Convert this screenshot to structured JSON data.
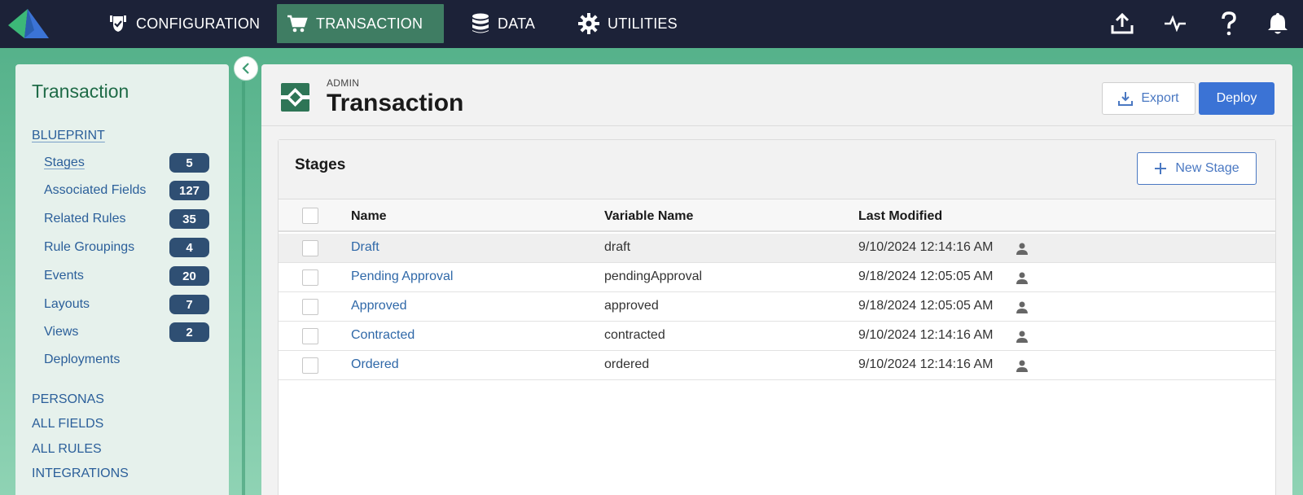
{
  "nav": {
    "items": [
      {
        "label": "CONFIGURATION",
        "icon": "shield-check-icon"
      },
      {
        "label": "TRANSACTION",
        "icon": "shopping-cart-icon"
      },
      {
        "label": "DATA",
        "icon": "database-icon"
      },
      {
        "label": "UTILITIES",
        "icon": "gear-icon"
      }
    ],
    "active": "TRANSACTION",
    "right_icons": [
      "upload-icon",
      "activity-icon",
      "help-icon",
      "bell-icon"
    ]
  },
  "sidebar": {
    "title": "Transaction",
    "blueprint_label": "BLUEPRINT",
    "items": [
      {
        "label": "Stages",
        "count": "5"
      },
      {
        "label": "Associated Fields",
        "count": "127"
      },
      {
        "label": "Related Rules",
        "count": "35"
      },
      {
        "label": "Rule Groupings",
        "count": "4"
      },
      {
        "label": "Events",
        "count": "20"
      },
      {
        "label": "Layouts",
        "count": "7"
      },
      {
        "label": "Views",
        "count": "2"
      },
      {
        "label": "Deployments",
        "count": ""
      }
    ],
    "sections": [
      "PERSONAS",
      "ALL FIELDS",
      "ALL RULES",
      "INTEGRATIONS"
    ]
  },
  "header": {
    "overline": "ADMIN",
    "title": "Transaction",
    "export_label": "Export",
    "deploy_label": "Deploy"
  },
  "stages": {
    "title": "Stages",
    "new_label": "New Stage",
    "columns": [
      "Name",
      "Variable Name",
      "Last Modified"
    ],
    "rows": [
      {
        "name": "Draft",
        "variable": "draft",
        "modified": "9/10/2024 12:14:16 AM"
      },
      {
        "name": "Pending Approval",
        "variable": "pendingApproval",
        "modified": "9/18/2024 12:05:05 AM"
      },
      {
        "name": "Approved",
        "variable": "approved",
        "modified": "9/18/2024 12:05:05 AM"
      },
      {
        "name": "Contracted",
        "variable": "contracted",
        "modified": "9/10/2024 12:14:16 AM"
      },
      {
        "name": "Ordered",
        "variable": "ordered",
        "modified": "9/10/2024 12:14:16 AM"
      }
    ]
  },
  "colors": {
    "topbar": "#1c2238",
    "active_nav": "#3f7d63",
    "accent_blue": "#3b73d5",
    "badge": "#2f4f73",
    "sidebar_title": "#1f6b47"
  }
}
